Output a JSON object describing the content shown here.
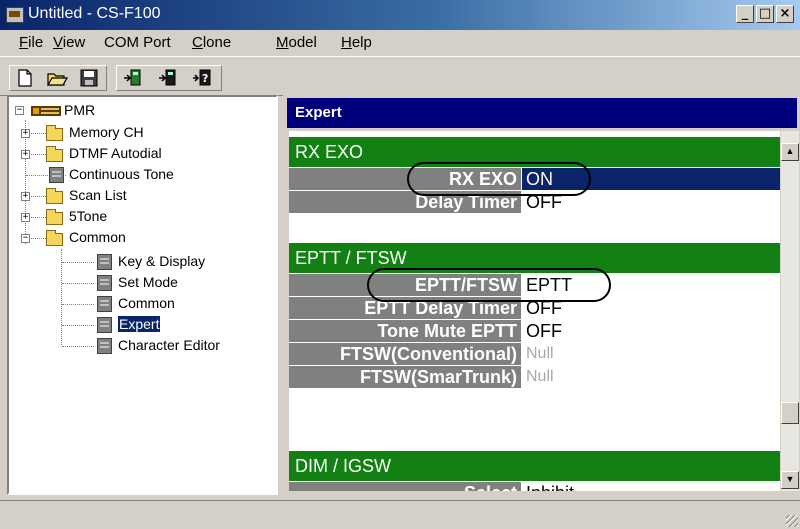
{
  "window": {
    "title": "Untitled - CS-F100",
    "minimize": "_",
    "maximize": "□",
    "close": "×"
  },
  "menu": [
    "File",
    "View",
    "COM Port",
    "Clone",
    "Model",
    "Help"
  ],
  "menu_underline": [
    "F",
    "V",
    "",
    "C",
    "M",
    "H"
  ],
  "toolbar": {
    "icons": [
      "new-file-icon",
      "open-folder-icon",
      "save-icon",
      "read-from-radio-icon",
      "write-to-radio-icon",
      "help-cursor-icon"
    ]
  },
  "tree": {
    "root": "PMR",
    "items": [
      {
        "label": "Memory CH",
        "icon": "folder-icon",
        "expander": "+"
      },
      {
        "label": "DTMF Autodial",
        "icon": "folder-icon",
        "expander": "+"
      },
      {
        "label": "Continuous Tone",
        "icon": "document-icon",
        "expander": ""
      },
      {
        "label": "Scan List",
        "icon": "folder-icon",
        "expander": "+"
      },
      {
        "label": "5Tone",
        "icon": "folder-icon",
        "expander": "+"
      },
      {
        "label": "Common",
        "icon": "folder-icon",
        "expander": "−"
      }
    ],
    "children": [
      {
        "label": "Key & Display",
        "icon": "document-icon"
      },
      {
        "label": "Set Mode",
        "icon": "document-icon"
      },
      {
        "label": "Common",
        "icon": "document-icon"
      },
      {
        "label": "Expert",
        "icon": "document-icon",
        "selected": true
      },
      {
        "label": "Character Editor",
        "icon": "document-icon"
      }
    ]
  },
  "panel": {
    "title": "Expert",
    "sections": [
      {
        "title": "RX EXO",
        "rows": [
          {
            "label": "RX EXO",
            "value": "ON",
            "selected": true,
            "circled": true
          },
          {
            "label": "Delay Timer",
            "value": "OFF"
          }
        ]
      },
      {
        "title": "EPTT / FTSW",
        "rows": [
          {
            "label": "EPTT/FTSW",
            "value": "EPTT",
            "circled": true
          },
          {
            "label": "EPTT Delay Timer",
            "value": "OFF"
          },
          {
            "label": "Tone Mute EPTT",
            "value": "OFF"
          },
          {
            "label": "FTSW(Conventional)",
            "value": "Null",
            "disabled": true
          },
          {
            "label": "FTSW(SmarTrunk)",
            "value": "Null",
            "disabled": true
          }
        ]
      },
      {
        "title": "DIM / IGSW",
        "rows": [
          {
            "label": "Select",
            "value": "Inhibit"
          }
        ]
      }
    ]
  },
  "scrollbar": {
    "up": "▲",
    "down": "▼"
  },
  "colors": {
    "section_green": "#128012",
    "header_blue": "#00007c",
    "selection_navy": "#0a246a",
    "label_gray": "#808080"
  }
}
